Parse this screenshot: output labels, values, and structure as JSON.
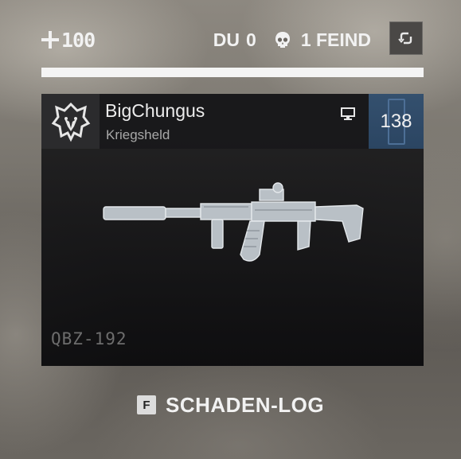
{
  "hud": {
    "health_value": "100",
    "own_count_label": "DU",
    "own_count": "0",
    "enemy_count_label": "1 FEIND",
    "health_fill": 1.0
  },
  "card": {
    "player_name": "BigChungus",
    "player_title": "Kriegsheld",
    "rank": "138",
    "weapon_name": "QBZ-192",
    "platform_icon": "monitor-icon",
    "emblem_icon": "wolf-emblem-icon",
    "colors": {
      "rank_bg": "#2f4a68",
      "panel_bg": "#1a1a1c"
    }
  },
  "footer": {
    "key": "F",
    "label": "SCHADEN-LOG"
  }
}
